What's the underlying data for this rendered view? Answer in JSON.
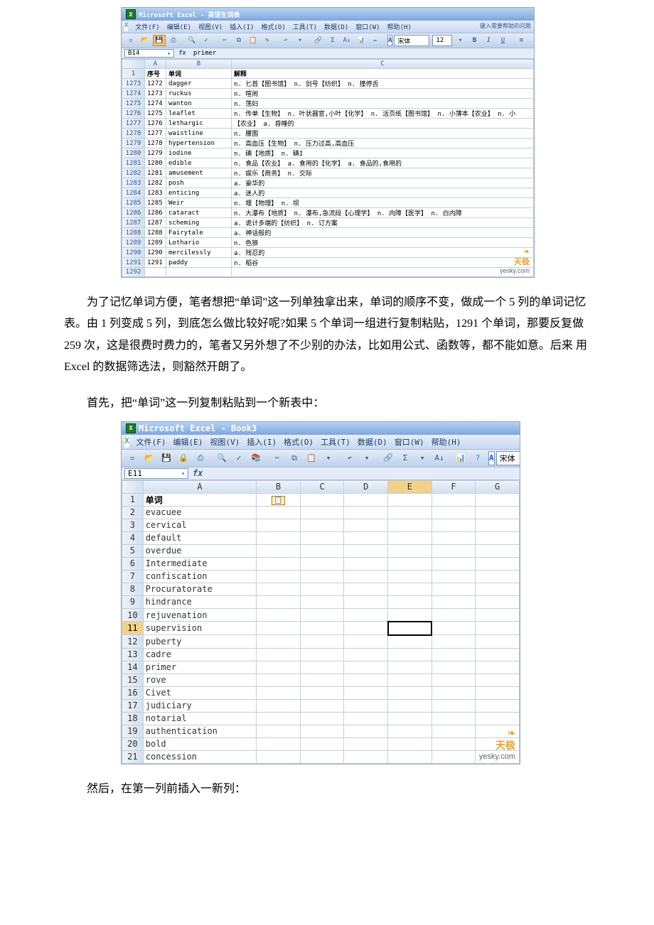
{
  "para1": "为了记忆单词方便，笔者想把“单词”这一列单独拿出来，单词的顺序不变，做成一个 5 列的单词记忆表。由 1 列变成 5 列，到底怎么做比较好呢?如果 5 个单词一组进行复制粘贴，1291 个单词，那要反复做 259 次，这是很费时费力的，笔者又另外想了不少别的办法，比如用公式、函数等，都不能如意。后来 用 Excel 的数据筛选法，则豁然开朗了。",
  "para2": "首先，把“单词”这一列复制粘贴到一个新表中：",
  "para3": "然后，在第一列前插入一新列：",
  "excel1": {
    "title": "Microsoft Excel - 英语生词表",
    "menus": [
      "文件(F)",
      "编辑(E)",
      "视图(V)",
      "插入(I)",
      "格式(O)",
      "工具(T)",
      "数据(D)",
      "窗口(W)",
      "帮助(H)"
    ],
    "help_hint": "键入需要帮助的问题",
    "font_name": "宋体",
    "font_size": "12",
    "namebox": "B14",
    "formula": "primer",
    "col_headers": [
      "序号",
      "单词",
      "解释"
    ],
    "col_letters": [
      "A",
      "B",
      "C"
    ],
    "rows": [
      {
        "n": "1273",
        "c": [
          "1272",
          "dagger",
          "n. 匕首【图书馆】 n. 剑号【纺织】 n. 撞停舌"
        ]
      },
      {
        "n": "1274",
        "c": [
          "1273",
          "ruckus",
          "n. 喧闹"
        ]
      },
      {
        "n": "1275",
        "c": [
          "1274",
          "wanton",
          "n. 荡妇"
        ]
      },
      {
        "n": "1276",
        "c": [
          "1275",
          "leaflet",
          "n. 传单【生物】 n. 叶状器官,小叶【化学】 n. 活页纸【图书馆】 n. 小薄本【农业】 n. 小"
        ]
      },
      {
        "n": "1277",
        "c": [
          "1276",
          "lethargic",
          "【农业】 a. 昏睡的"
        ]
      },
      {
        "n": "1278",
        "c": [
          "1277",
          "waistline",
          "n. 腰围"
        ]
      },
      {
        "n": "1279",
        "c": [
          "1278",
          "hypertension",
          "n. 高血压【生物】 n. 压力过高,高血压"
        ]
      },
      {
        "n": "1280",
        "c": [
          "1279",
          "iodine",
          "n. 碘【地质】 n. 碘I"
        ]
      },
      {
        "n": "1281",
        "c": [
          "1280",
          "edible",
          "n. 食品【农业】 a. 食用的【化学】 a. 食品的,食用的"
        ]
      },
      {
        "n": "1282",
        "c": [
          "1281",
          "amusement",
          "n. 娱乐【商务】 n. 交际"
        ]
      },
      {
        "n": "1283",
        "c": [
          "1282",
          "posh",
          "a. 豪华的"
        ]
      },
      {
        "n": "1284",
        "c": [
          "1283",
          "enticing",
          "a. 迷人的"
        ]
      },
      {
        "n": "1285",
        "c": [
          "1285",
          "Weir",
          "n. 堰【物理】 n. 坝"
        ]
      },
      {
        "n": "1286",
        "c": [
          "1286",
          "cataract",
          "n. 大瀑布【地质】 n. 瀑布,急流段【心理学】 n. 内障【医学】 n. 白内障"
        ]
      },
      {
        "n": "1287",
        "c": [
          "1287",
          "scheming",
          "a. 诡计多端的【纺织】 n. 订方案"
        ]
      },
      {
        "n": "1288",
        "c": [
          "1288",
          "Fairytale",
          "a. 神话般的"
        ]
      },
      {
        "n": "1289",
        "c": [
          "1289",
          "Lothario",
          "n. 色狼"
        ]
      },
      {
        "n": "1290",
        "c": [
          "1290",
          "mercilessly",
          "a. 残忍的"
        ]
      },
      {
        "n": "1291",
        "c": [
          "1291",
          "paddy",
          "n. 稻谷"
        ]
      },
      {
        "n": "1292",
        "c": [
          "",
          "",
          ""
        ]
      }
    ]
  },
  "excel2": {
    "title": "Microsoft Excel - Book3",
    "menus": [
      "文件(F)",
      "编辑(E)",
      "视图(V)",
      "插入(I)",
      "格式(O)",
      "工具(T)",
      "数据(D)",
      "窗口(W)",
      "帮助(H)"
    ],
    "font_name": "宋体",
    "namebox": "E11",
    "formula": "",
    "col_letters": [
      "A",
      "B",
      "C",
      "D",
      "E",
      "F",
      "G"
    ],
    "hdr_label": "单词",
    "sel_col_idx": 4,
    "sel_row_idx": 11,
    "words": [
      "evacuee",
      "cervical",
      "default",
      "overdue",
      "Intermediate",
      "confiscation",
      "Procuratorate",
      "hindrance",
      "rejuvenation",
      "supervision",
      "puberty",
      "cadre",
      "primer",
      "rove",
      "Civet",
      "judiciary",
      "notarial",
      "authentication",
      "bold",
      "concession"
    ]
  },
  "watermark": {
    "brand": "天极",
    "url": "yesky.com"
  }
}
